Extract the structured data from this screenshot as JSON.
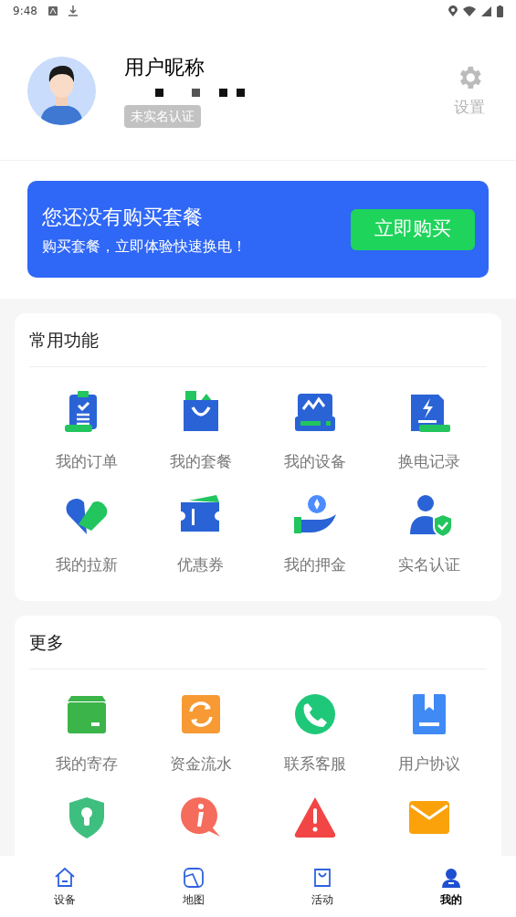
{
  "status_bar": {
    "time": "9:48"
  },
  "profile": {
    "nickname": "用户昵称",
    "verify_badge": "未实名认证",
    "settings_label": "设置"
  },
  "banner": {
    "title": "您还没有购买套餐",
    "subtitle": "购买套餐，立即体验快速换电！",
    "button": "立即购买"
  },
  "sections": [
    {
      "title": "常用功能",
      "items": [
        {
          "kind": "labeled",
          "label": "我的订单"
        },
        {
          "kind": "labeled",
          "label": "我的套餐"
        },
        {
          "kind": "labeled",
          "label": "我的设备"
        },
        {
          "kind": "labeled",
          "label": "换电记录"
        },
        {
          "kind": "labeled",
          "label": "我的拉新"
        },
        {
          "kind": "labeled",
          "label": "优惠券"
        },
        {
          "kind": "labeled",
          "label": "我的押金"
        },
        {
          "kind": "labeled",
          "label": "实名认证"
        }
      ]
    },
    {
      "title": "更多",
      "items": [
        {
          "kind": "labeled",
          "label": "我的寄存"
        },
        {
          "kind": "labeled",
          "label": "资金流水"
        },
        {
          "kind": "labeled",
          "label": "联系客服"
        },
        {
          "kind": "labeled",
          "label": "用户协议"
        },
        {
          "kind": "icon"
        },
        {
          "kind": "icon"
        },
        {
          "kind": "icon"
        },
        {
          "kind": "icon"
        }
      ]
    }
  ],
  "bottom_nav": [
    {
      "label": "设备",
      "selected": false
    },
    {
      "label": "地图",
      "selected": false
    },
    {
      "label": "活动",
      "selected": false
    },
    {
      "label": "我的",
      "selected": true
    }
  ]
}
